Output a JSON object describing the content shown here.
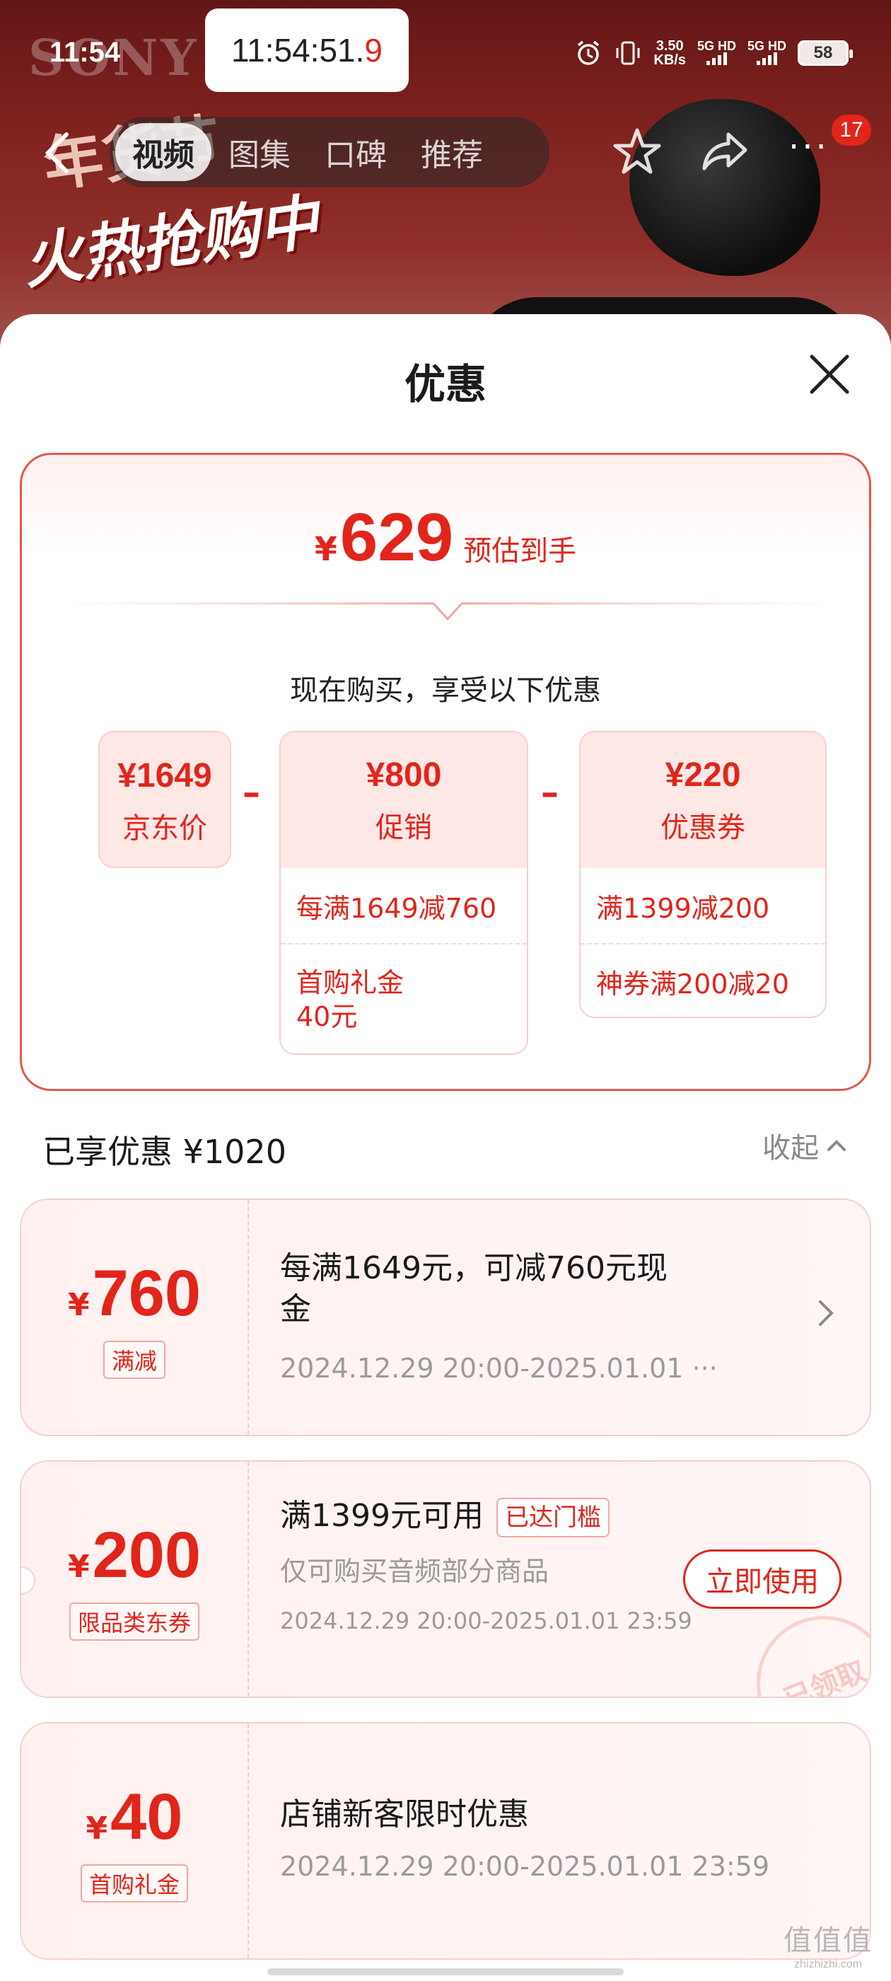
{
  "status_bar": {
    "time": "11:54",
    "clock_main": "11:54:51.",
    "clock_frac": "9",
    "net_speed_value": "3.50",
    "net_speed_unit": "KB/s",
    "sim1": "5G HD",
    "sim2": "5G HD",
    "battery": "58"
  },
  "hero": {
    "brand_text": "SONY",
    "promo_line1": "年货节",
    "promo_line2": "火热抢购中"
  },
  "nav": {
    "tabs": [
      {
        "label": "视频",
        "active": true
      },
      {
        "label": "图集",
        "active": false
      },
      {
        "label": "口碑",
        "active": false
      },
      {
        "label": "推荐",
        "active": false
      }
    ],
    "more_label": "···",
    "badge_count": "17"
  },
  "sheet": {
    "title": "优惠",
    "summary": {
      "currency": "¥",
      "estimated_price": "629",
      "estimated_label": "预估到手",
      "subtitle": "现在购买，享受以下优惠",
      "minus": "–",
      "jd_price": {
        "value": "¥1649",
        "name": "京东价"
      },
      "promotion": {
        "value": "¥800",
        "name": "促销",
        "details": [
          "每满1649减760",
          "首购礼金\n40元"
        ]
      },
      "coupon": {
        "value": "¥220",
        "name": "优惠券",
        "details": [
          "满1399减200",
          "神券满200减20"
        ]
      }
    },
    "enjoyed_label": "已享优惠 ¥1020",
    "collapse_label": "收起",
    "coupons": [
      {
        "currency": "¥",
        "amount": "760",
        "tag": "满减",
        "title": "每满1649元，可减760元现\n金",
        "validity": "2024.12.29 20:00-2025.01.01 ···"
      },
      {
        "currency": "¥",
        "amount": "200",
        "tag": "限品类东券",
        "title": "满1399元可用",
        "reached_label": "已达门槛",
        "scope": "仅可购买音频部分商品",
        "validity": "2024.12.29 20:00-2025.01.01 23:59",
        "button_label": "立即使用",
        "stamp_label": "已领取"
      },
      {
        "currency": "¥",
        "amount": "40",
        "tag": "首购礼金",
        "title": "店铺新客限时优惠",
        "validity": "2024.12.29 20:00-2025.01.01 23:59"
      }
    ]
  },
  "watermark": {
    "line1": "值值值",
    "line2": "zhizhizhi.com"
  },
  "colors": {
    "accent": "#e1251b",
    "accent_light": "#fde8e6",
    "border": "#f6cfcb",
    "muted": "#9a9a9a"
  }
}
